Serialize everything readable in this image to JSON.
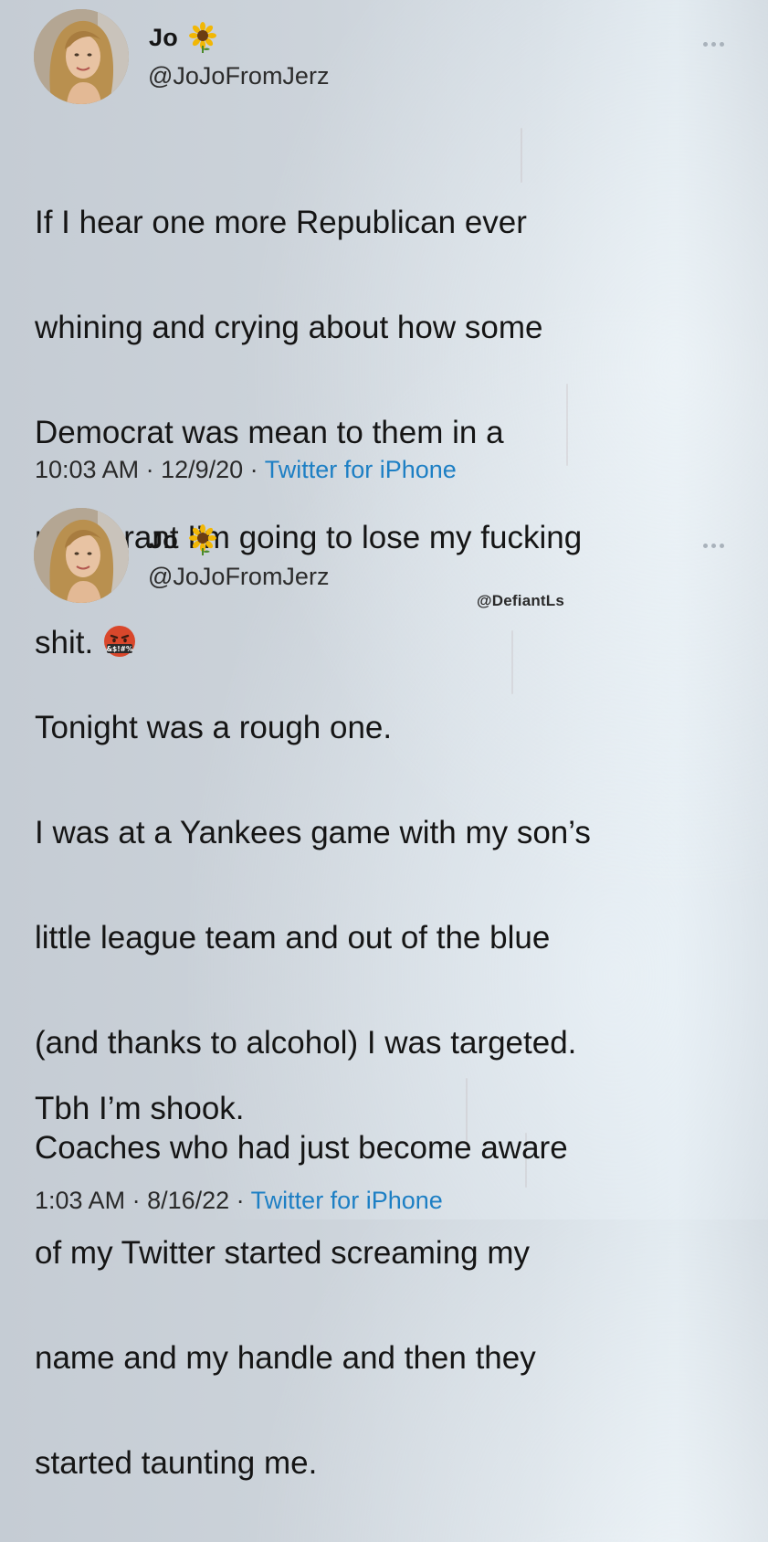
{
  "tweets": [
    {
      "author": {
        "name": "Jo",
        "handle": "@JoJoFromJerz",
        "name_icon": "sunflower-icon"
      },
      "text_lines": [
        "If I hear one more Republican ever",
        "whining and crying about how some",
        "Democrat was mean to them in a",
        "restaurant I’m going to lose my fucking",
        "shit."
      ],
      "trailing_emoji": "face-with-symbols-icon",
      "time": "10:03 AM",
      "date": "12/9/20",
      "source": "Twitter for iPhone"
    },
    {
      "author": {
        "name": "Jo",
        "handle": "@JoJoFromJerz",
        "name_icon": "sunflower-icon"
      },
      "text_lines": [
        "Tonight was a rough one.",
        "I was at a Yankees game with my son’s",
        "little league team and out of the blue",
        "(and thanks to alcohol) I was targeted.",
        "Coaches who had just become aware",
        "of my Twitter started screaming my",
        "name and my handle and then they",
        "started taunting me."
      ],
      "closing_line": "Tbh I’m shook.",
      "time": "1:03 AM",
      "date": "8/16/22",
      "source": "Twitter for iPhone"
    }
  ],
  "watermark": "@DefiantLs",
  "separator": " · ",
  "colors": {
    "source_link": "#1d7fc4",
    "text": "#151515"
  }
}
